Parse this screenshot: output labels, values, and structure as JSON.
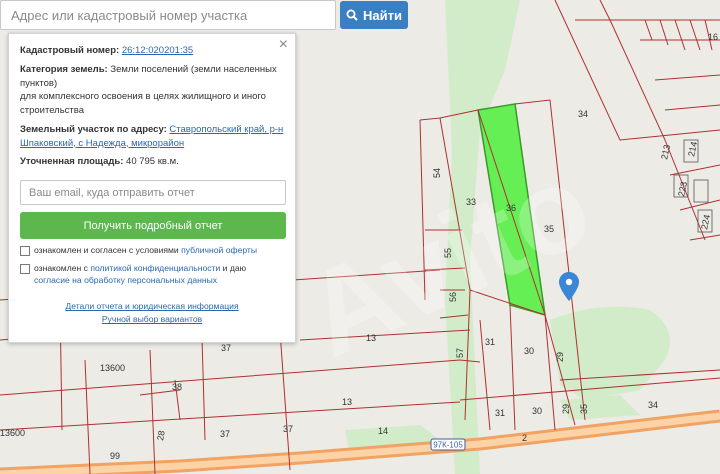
{
  "search": {
    "placeholder": "Адрес или кадастровый номер участка",
    "button_label": "Найти"
  },
  "panel": {
    "close_label": "×",
    "cadastral_number_label": "Кадастровый номер:",
    "cadastral_number": "26:12:020201:35",
    "land_category_label": "Категория земель:",
    "land_category_value": "Земли поселений (земли населенных пунктов)",
    "land_use_value": "для комплексного освоения в целях жилищного и иного строительства",
    "address_label": "Земельный участок по адресу:",
    "address_link": "Ставропольский край, р-н Шпаковский, с Надежда, микрорайон",
    "area_label": "Уточненная площадь:",
    "area_value": "40 795 кв.м.",
    "email_placeholder": "Ваш email, куда отправить отчет",
    "report_button_label": "Получить подробный отчет",
    "consent1_prefix": "ознакомлен и согласен с условиями",
    "consent1_link": "публичной оферты",
    "consent2_prefix": "ознакомлен с",
    "consent2_link": "политикой конфиденциальности",
    "consent2_middle": "и даю",
    "consent2_link2": "согласие на обработку персональных данных",
    "details_link": "Детали отчета и юридическая информация",
    "manual_link": "Ручной выбор вариантов"
  },
  "map": {
    "parcel_labels": [
      "16",
      "34",
      "213",
      "214",
      "223",
      "224",
      "54",
      "33",
      "36",
      "35",
      "55",
      "56",
      "13",
      "31",
      "30",
      "29",
      "57",
      "37",
      "13600",
      "38",
      "13",
      "14",
      "31",
      "30",
      "29",
      "35",
      "34",
      "2",
      "28",
      "37",
      "37",
      "13600",
      "99"
    ],
    "road_label": "97К-105",
    "selected_color": "#66ee55",
    "boundary_color": "#b03030",
    "road_color": "#f2a262"
  },
  "icons": {
    "search": "search-icon",
    "close": "close-icon",
    "marker": "map-marker-icon"
  }
}
